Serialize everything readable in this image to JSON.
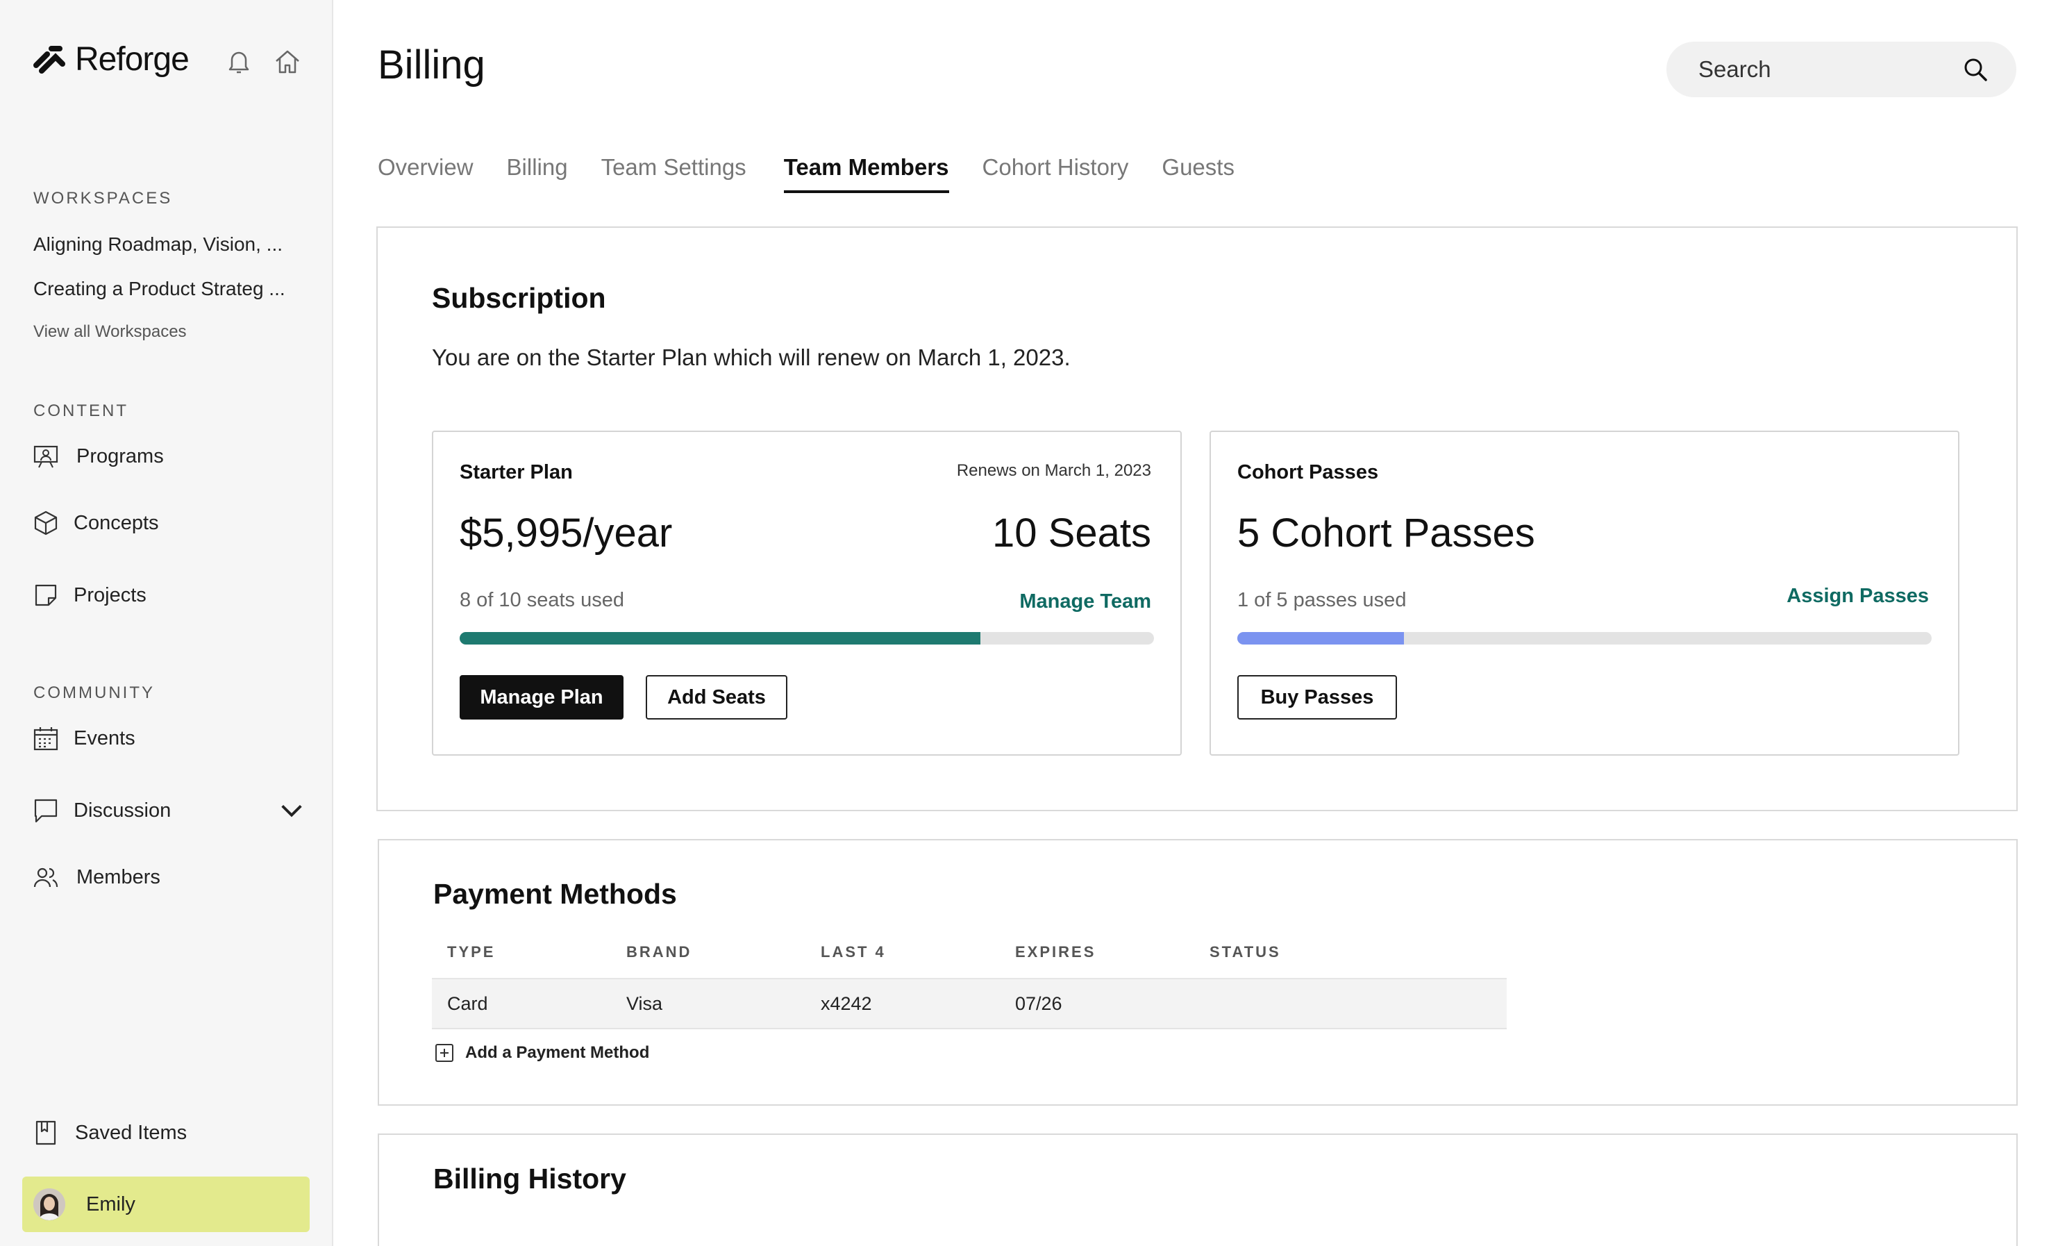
{
  "app": {
    "name": "Reforge"
  },
  "sidebar": {
    "workspaces_label": "WORKSPACES",
    "workspaces": [
      "Aligning Roadmap, Vision, ...",
      "Creating a Product Strateg ..."
    ],
    "view_all": "View all Workspaces",
    "content_label": "CONTENT",
    "content_items": [
      {
        "label": "Programs",
        "icon": "presentation-icon"
      },
      {
        "label": "Concepts",
        "icon": "cube-icon"
      },
      {
        "label": "Projects",
        "icon": "note-icon"
      }
    ],
    "community_label": "COMMUNITY",
    "community_items": [
      {
        "label": "Events",
        "icon": "calendar-icon"
      },
      {
        "label": "Discussion",
        "icon": "chat-icon"
      },
      {
        "label": "Members",
        "icon": "members-icon"
      }
    ],
    "saved_items": "Saved Items",
    "user": {
      "name": "Emily"
    }
  },
  "header": {
    "title": "Billing",
    "search_placeholder": "Search"
  },
  "tabs": [
    {
      "label": "Overview",
      "active": false
    },
    {
      "label": "Billing",
      "active": false
    },
    {
      "label": "Team Settings",
      "active": false
    },
    {
      "label": "Team Members",
      "active": true
    },
    {
      "label": "Cohort History",
      "active": false
    },
    {
      "label": "Guests",
      "active": false
    }
  ],
  "subscription": {
    "title": "Subscription",
    "description": "You are on the Starter Plan which will renew on March 1, 2023.",
    "plan_card": {
      "name": "Starter Plan",
      "renews": "Renews on March 1, 2023",
      "price": "$5,995/year",
      "seats": "10 Seats",
      "usage": "8 of 10 seats used",
      "usage_fraction": 0.75,
      "manage_team": "Manage Team",
      "manage_plan": "Manage Plan",
      "add_seats": "Add Seats"
    },
    "cohort_card": {
      "name": "Cohort Passes",
      "count": "5 Cohort Passes",
      "usage": "1 of 5 passes used",
      "usage_fraction": 0.24,
      "assign": "Assign Passes",
      "buy": "Buy Passes"
    }
  },
  "payment_methods": {
    "title": "Payment Methods",
    "columns": [
      "TYPE",
      "BRAND",
      "LAST 4",
      "EXPIRES",
      "STATUS"
    ],
    "rows": [
      [
        "Card",
        "Visa",
        "x4242",
        "07/26",
        ""
      ]
    ],
    "add_label": "Add a Payment Method"
  },
  "billing_history": {
    "title": "Billing History"
  },
  "colors": {
    "accent_teal": "#1e7a70",
    "accent_blue": "#7b93f0",
    "user_card": "#e3ea8d"
  }
}
